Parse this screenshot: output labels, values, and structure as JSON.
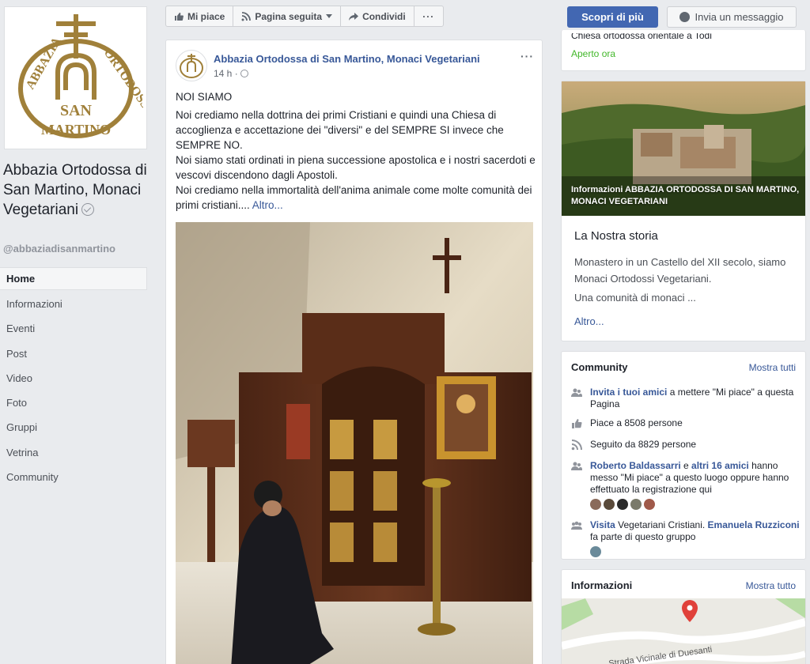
{
  "page": {
    "name": "Abbazia Ortodossa di San Martino, Monaci Vegetariani",
    "handle": "@abbaziadisanmartino",
    "logo_text": "ABBAZIA ORTODOSSA DI SAN MARTINO"
  },
  "nav": {
    "items": [
      "Home",
      "Informazioni",
      "Eventi",
      "Post",
      "Video",
      "Foto",
      "Gruppi",
      "Vetrina",
      "Community"
    ]
  },
  "toolbar": {
    "like_label": "Mi piace",
    "follow_label": "Pagina seguita",
    "share_label": "Condividi",
    "more_label": "···",
    "discover_label": "Scopri di più",
    "message_label": "Invia un messaggio"
  },
  "post": {
    "author": "Abbazia Ortodossa di San Martino, Monaci Vegetariani",
    "time": "14 h ·",
    "menu": "···",
    "heading": "NOI SIAMO",
    "paragraph1": "Noi crediamo nella dottrina dei primi Cristiani e quindi una Chiesa di accoglienza e accettazione dei \"diversi\" e del SEMPRE SI invece che SEMPRE NO.",
    "paragraph2": "Noi siamo stati ordinati in piena successione apostolica e i nostri sacerdoti e vescovi discendono dagli Apostoli.",
    "paragraph3": "Noi crediamo nella immortalità dell'anima animale come molte comunità dei primi cristiani....",
    "more": "Altro..."
  },
  "top_card": {
    "address": "Chiesa ortodossa orientale a Todi",
    "status": "Aperto ora",
    "status_color": "#42b72a"
  },
  "story": {
    "caption": "Informazioni ABBAZIA ORTODOSSA DI SAN MARTINO, MONACI VEGETARIANI",
    "title": "La Nostra storia",
    "body": "Monastero in un Castello del XII secolo, siamo Monaci Ortodossi Vegetariani.",
    "body2": "Una comunità di monaci ...",
    "more": "Altro..."
  },
  "community": {
    "title": "Community",
    "see_all": "Mostra tutti",
    "invite_link": "Invita i tuoi amici",
    "invite_text": " a mettere \"Mi piace\" a questa Pagina",
    "likes": "Piace a 8508 persone",
    "followers": "Seguito da 8829 persone",
    "friend1": "Roberto Baldassarri",
    "and": " e ",
    "friends_others": "altri 16 amici",
    "friends_text": " hanno messo \"Mi piace\" a questo luogo oppure hanno effettuato la registrazione qui",
    "visit_link": "Visita",
    "visit_text": " Vegetariani Cristiani. ",
    "member": "Emanuela Ruzziconi",
    "member_text": " fa parte di questo gruppo"
  },
  "info": {
    "title": "Informazioni",
    "see_all": "Mostra tutto",
    "map_label": "Strada Vicinale di Duesanti"
  },
  "colors": {
    "accent": "#4267b2",
    "link": "#385898",
    "background": "#e9ebee",
    "logo_gold": "#a0803a"
  }
}
